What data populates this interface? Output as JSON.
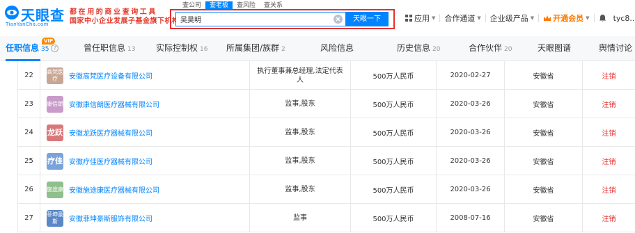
{
  "header": {
    "logo_text": "天眼查",
    "logo_sub": "TianYanCha.com",
    "slogan_line1": "都在用的商业查询工具",
    "slogan_line2": "国家中小企业发展子基金旗下机构",
    "search_tabs": [
      "查公司",
      "查老板",
      "查风险",
      "查关系"
    ],
    "search_value": "吴昊明",
    "search_button": "天眼一下",
    "nav": {
      "app": "应用",
      "channel": "合作通道",
      "enterprise": "企业级产品",
      "vip": "开通会员",
      "user": "tyc8..."
    }
  },
  "tabs": [
    {
      "label": "任职信息",
      "count": "35",
      "vip": "VIP"
    },
    {
      "label": "曾任职信息",
      "count": "13"
    },
    {
      "label": "实际控制权",
      "count": "16"
    },
    {
      "label": "所属集团/族群",
      "count": "2"
    },
    {
      "label": "风险信息",
      "count": ""
    },
    {
      "label": "历史信息",
      "count": "20"
    },
    {
      "label": "合作伙伴",
      "count": "20"
    },
    {
      "label": "天眼图谱",
      "count": ""
    },
    {
      "label": "舆情讨论",
      "count": ""
    }
  ],
  "rows": [
    {
      "index": "22",
      "logo": "高梵医疗",
      "logo_color": "#c9a594",
      "company": "安徽高梵医疗设备有限公司",
      "position": "执行董事兼总经理,法定代表人",
      "capital": "500万人民币",
      "date": "2020-02-27",
      "province": "安徽省",
      "status": "注销"
    },
    {
      "index": "23",
      "logo": "康信朗",
      "logo_color": "#c89bc8",
      "company": "安徽康信朗医疗器械有限公司",
      "position": "监事,股东",
      "capital": "500万人民币",
      "date": "2020-03-26",
      "province": "安徽省",
      "status": "注销"
    },
    {
      "index": "24",
      "logo": "龙跃",
      "logo_color": "#d9777a",
      "company": "安徽龙跃医疗器械有限公司",
      "position": "监事,股东",
      "capital": "500万人民币",
      "date": "2020-03-26",
      "province": "安徽省",
      "status": "注销"
    },
    {
      "index": "25",
      "logo": "疗佳",
      "logo_color": "#7aa3d9",
      "company": "安徽疗佳医疗器械有限公司",
      "position": "监事,股东",
      "capital": "500万人民币",
      "date": "2020-03-26",
      "province": "安徽省",
      "status": "注销"
    },
    {
      "index": "26",
      "logo": "施途康",
      "logo_color": "#8fbf8c",
      "company": "安徽施途康医疗器械有限公司",
      "position": "监事,股东",
      "capital": "500万人民币",
      "date": "2020-03-26",
      "province": "安徽省",
      "status": "注销"
    },
    {
      "index": "27",
      "logo": "菲坤豪斯",
      "logo_color": "#5a87c8",
      "company": "安徽菲坤豪斯服饰有限公司",
      "position": "监事",
      "capital": "500万人民币",
      "date": "2008-07-16",
      "province": "安徽省",
      "status": "注销"
    }
  ]
}
